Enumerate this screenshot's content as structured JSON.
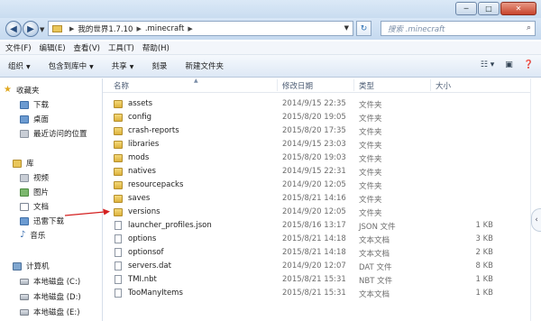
{
  "titlebar": {
    "minimize": "─",
    "maximize": "□",
    "close": "✕"
  },
  "address": {
    "crumbs": [
      "我的世界1.7.10",
      ".minecraft"
    ],
    "search_placeholder": "搜索 .minecraft"
  },
  "menu": [
    "文件(F)",
    "编辑(E)",
    "查看(V)",
    "工具(T)",
    "帮助(H)"
  ],
  "toolbar": {
    "organize": "组织",
    "include": "包含到库中",
    "share": "共享",
    "burn": "刻录",
    "new_folder": "新建文件夹"
  },
  "nav": {
    "favorites": "收藏夹",
    "downloads": "下载",
    "desktop": "桌面",
    "recent": "最近访问的位置",
    "libraries": "库",
    "videos": "视频",
    "pictures": "图片",
    "documents": "文档",
    "thunder": "迅雷下载",
    "music": "音乐",
    "computer": "计算机",
    "drive_c": "本地磁盘 (C:)",
    "drive_d": "本地磁盘 (D:)",
    "drive_e": "本地磁盘 (E:)"
  },
  "columns": {
    "name": "名称",
    "date": "修改日期",
    "type": "类型",
    "size": "大小"
  },
  "files": [
    {
      "name": "assets",
      "date": "2014/9/15 22:35",
      "type": "文件夹",
      "size": "",
      "kind": "folder"
    },
    {
      "name": "config",
      "date": "2015/8/20 19:05",
      "type": "文件夹",
      "size": "",
      "kind": "folder"
    },
    {
      "name": "crash-reports",
      "date": "2015/8/20 17:35",
      "type": "文件夹",
      "size": "",
      "kind": "folder"
    },
    {
      "name": "libraries",
      "date": "2014/9/15 23:03",
      "type": "文件夹",
      "size": "",
      "kind": "folder"
    },
    {
      "name": "mods",
      "date": "2015/8/20 19:03",
      "type": "文件夹",
      "size": "",
      "kind": "folder"
    },
    {
      "name": "natives",
      "date": "2014/9/15 22:31",
      "type": "文件夹",
      "size": "",
      "kind": "folder"
    },
    {
      "name": "resourcepacks",
      "date": "2014/9/20 12:05",
      "type": "文件夹",
      "size": "",
      "kind": "folder"
    },
    {
      "name": "saves",
      "date": "2015/8/21 14:16",
      "type": "文件夹",
      "size": "",
      "kind": "folder"
    },
    {
      "name": "versions",
      "date": "2014/9/20 12:05",
      "type": "文件夹",
      "size": "",
      "kind": "folder"
    },
    {
      "name": "launcher_profiles.json",
      "date": "2015/8/16 13:17",
      "type": "JSON 文件",
      "size": "1 KB",
      "kind": "file"
    },
    {
      "name": "options",
      "date": "2015/8/21 14:18",
      "type": "文本文档",
      "size": "3 KB",
      "kind": "file"
    },
    {
      "name": "optionsof",
      "date": "2015/8/21 14:18",
      "type": "文本文档",
      "size": "2 KB",
      "kind": "file"
    },
    {
      "name": "servers.dat",
      "date": "2014/9/20 12:07",
      "type": "DAT 文件",
      "size": "8 KB",
      "kind": "file"
    },
    {
      "name": "TMI.nbt",
      "date": "2015/8/21 15:31",
      "type": "NBT 文件",
      "size": "1 KB",
      "kind": "file"
    },
    {
      "name": "TooManyItems",
      "date": "2015/8/21 15:31",
      "type": "文本文档",
      "size": "1 KB",
      "kind": "file"
    }
  ],
  "colors": {
    "annotation_arrow": "#d42020",
    "folder": "#e9c65a"
  }
}
